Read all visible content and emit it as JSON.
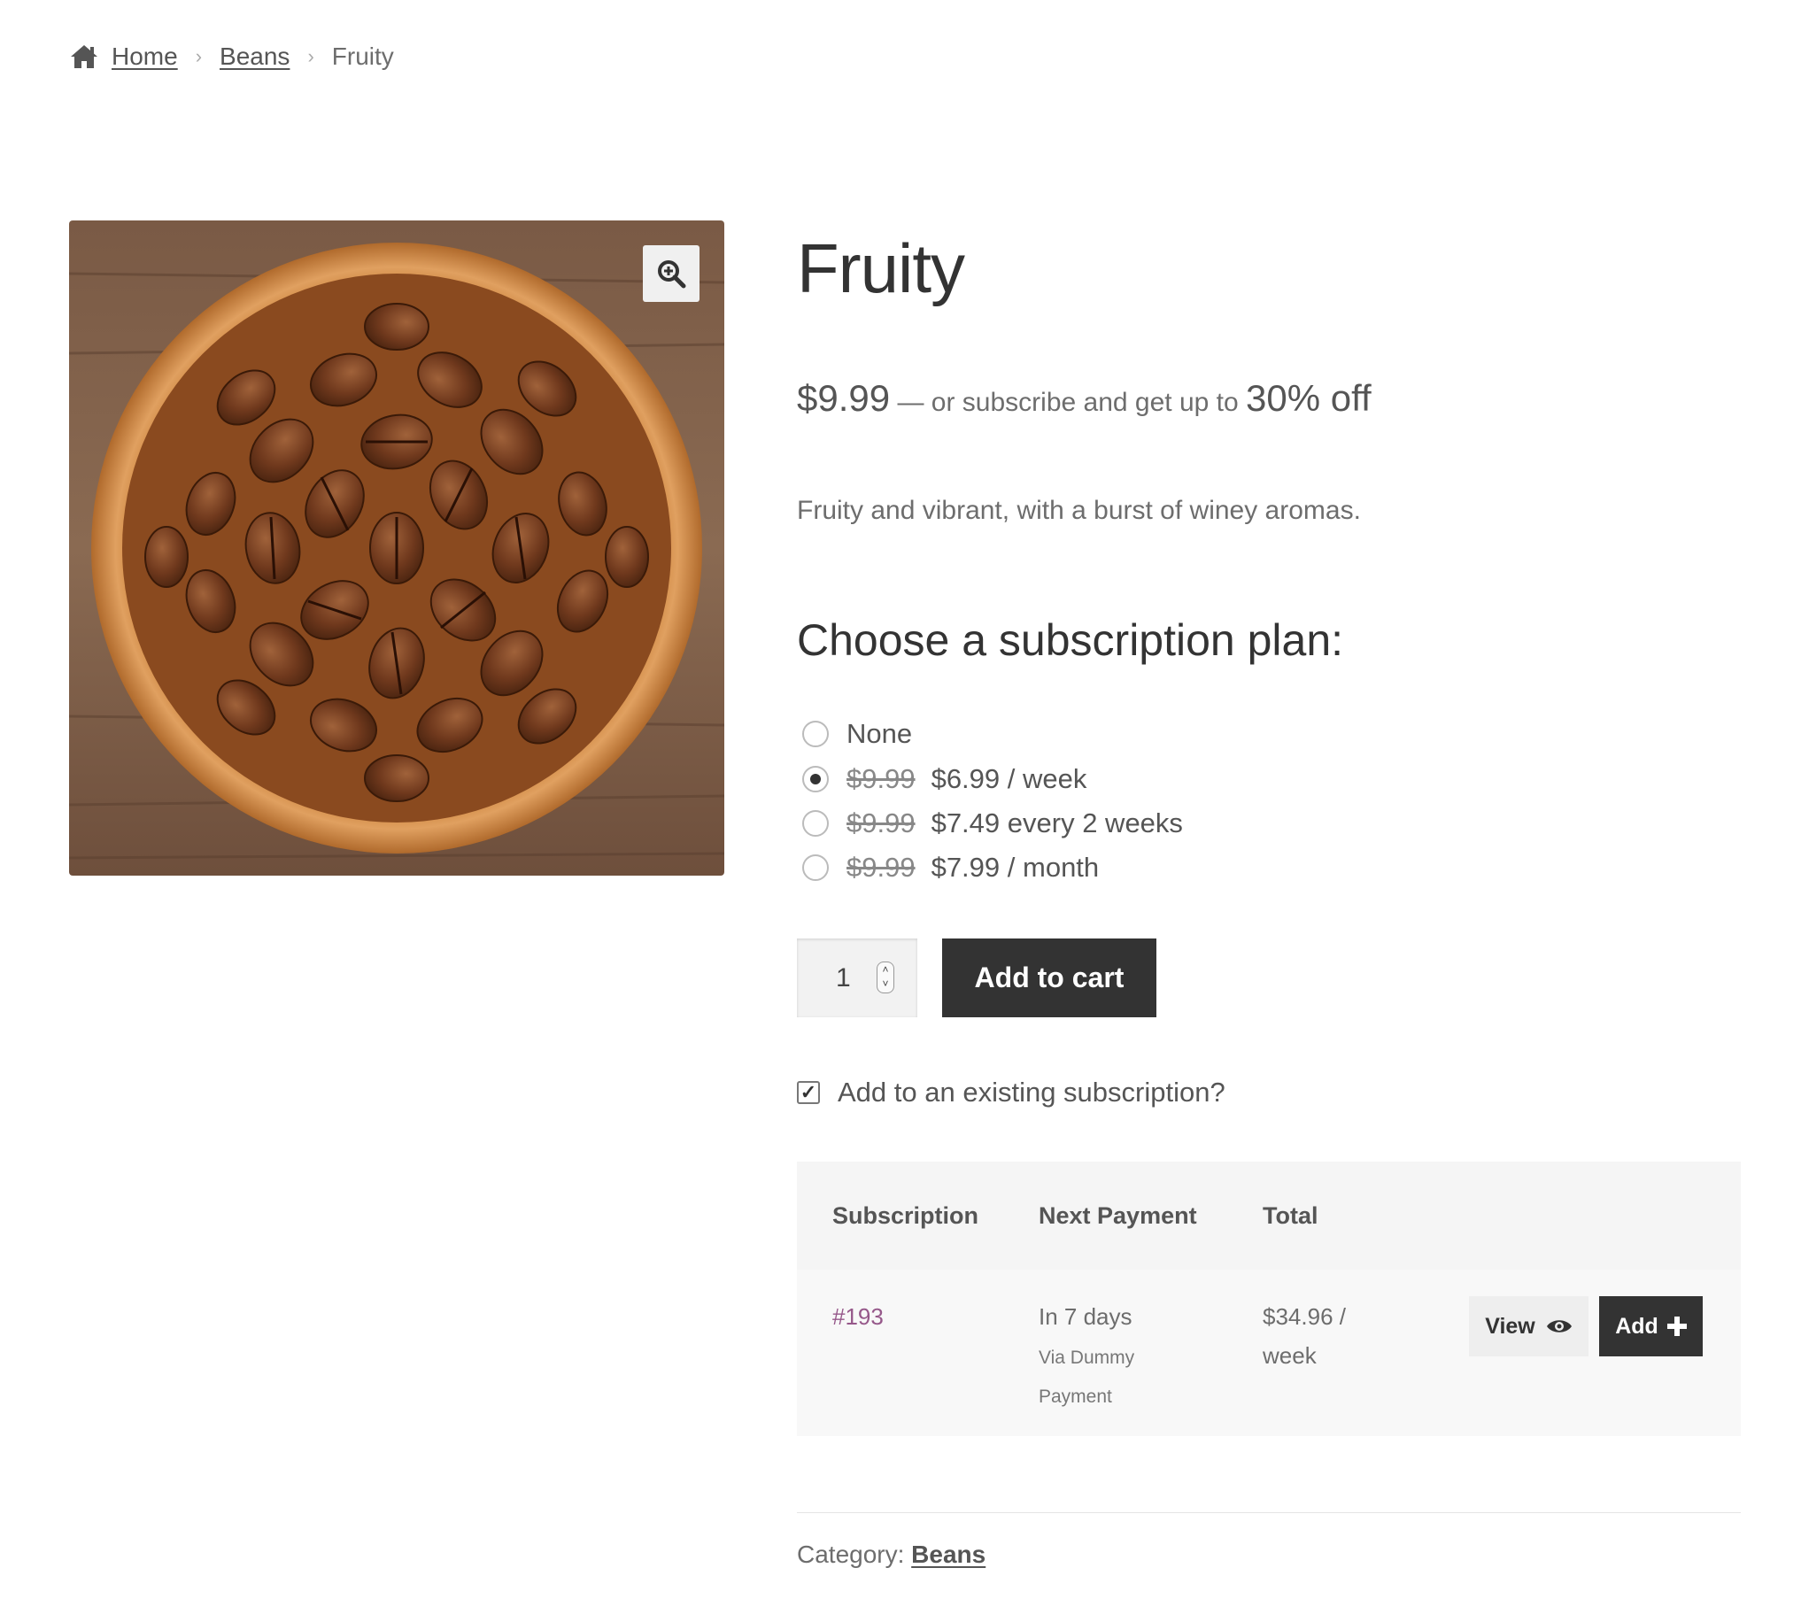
{
  "breadcrumb": {
    "home": "Home",
    "category": "Beans",
    "current": "Fruity",
    "separator": "›"
  },
  "product": {
    "title": "Fruity",
    "price": "$9.99",
    "price_suffix": " — or subscribe and get up to ",
    "discount": "30% off",
    "description": "Fruity and vibrant, with a burst of winey aromas.",
    "image_alt": "Bowl of roasted coffee beans",
    "zoom_icon": "zoom-in-icon"
  },
  "plans": {
    "heading": "Choose a subscription plan:",
    "options": [
      {
        "label": "None",
        "old_price": "",
        "new_price": "",
        "selected": false
      },
      {
        "label": "/ week",
        "old_price": "$9.99",
        "new_price": "$6.99",
        "selected": true
      },
      {
        "label": "every 2 weeks",
        "old_price": "$9.99",
        "new_price": "$7.49",
        "selected": false
      },
      {
        "label": "/ month",
        "old_price": "$9.99",
        "new_price": "$7.99",
        "selected": false
      }
    ]
  },
  "cart": {
    "quantity": "1",
    "add_to_cart_label": "Add to cart"
  },
  "existing_subscription": {
    "label": "Add to an existing subscription?",
    "checked": true
  },
  "table": {
    "headers": [
      "Subscription",
      "Next Payment",
      "Total"
    ],
    "row": {
      "id": "#193",
      "next_payment": "In 7 days",
      "via_line1": "Via Dummy",
      "via_line2": "Payment",
      "total_line1": "$34.96 /",
      "total_line2": "week",
      "view_label": "View",
      "add_label": "Add"
    }
  },
  "meta": {
    "category_label": "Category: ",
    "category_value": "Beans"
  },
  "colors": {
    "dark_button": "#333333",
    "link_purple": "#96588a",
    "text": "#6d6d6d"
  }
}
